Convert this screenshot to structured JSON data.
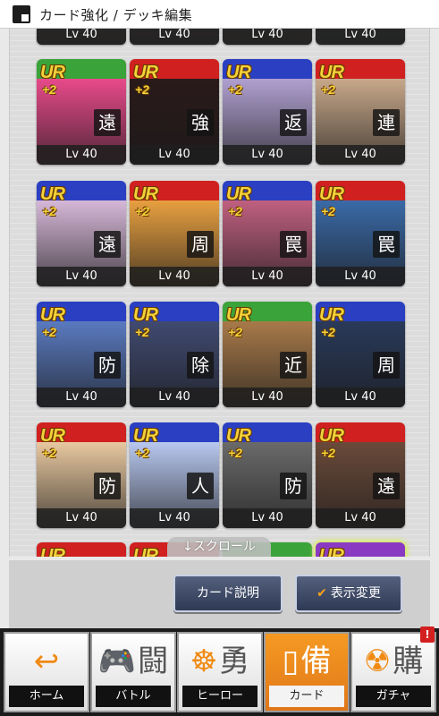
{
  "header": {
    "title": "カード強化 / デッキ編集"
  },
  "cards": [
    {
      "rarity": "UR",
      "plus": "+2",
      "kanji": "遠",
      "level": "Lv 40",
      "c1": "#3aa33a",
      "c2": "#e84a8a"
    },
    {
      "rarity": "UR",
      "plus": "+2",
      "kanji": "強",
      "level": "Lv 40",
      "c1": "#d02020",
      "c2": "#2a1a1a"
    },
    {
      "rarity": "UR",
      "plus": "+2",
      "kanji": "返",
      "level": "Lv 40",
      "c1": "#2a3fc2",
      "c2": "#b0a0d0"
    },
    {
      "rarity": "UR",
      "plus": "+2",
      "kanji": "連",
      "level": "Lv 40",
      "c1": "#d02020",
      "c2": "#c8a88a"
    },
    {
      "rarity": "UR",
      "plus": "+2",
      "kanji": "遠",
      "level": "Lv 40",
      "c1": "#2a3fc2",
      "c2": "#d6b8d8"
    },
    {
      "rarity": "UR",
      "plus": "+2",
      "kanji": "周",
      "level": "Lv 40",
      "c1": "#d02020",
      "c2": "#e8a040"
    },
    {
      "rarity": "UR",
      "plus": "+2",
      "kanji": "罠",
      "level": "Lv 40",
      "c1": "#2a3fc2",
      "c2": "#c06080"
    },
    {
      "rarity": "UR",
      "plus": "+2",
      "kanji": "罠",
      "level": "Lv 40",
      "c1": "#d02020",
      "c2": "#3a6aa8"
    },
    {
      "rarity": "UR",
      "plus": "+2",
      "kanji": "防",
      "level": "Lv 40",
      "c1": "#2a3fc2",
      "c2": "#5a7ac0"
    },
    {
      "rarity": "UR",
      "plus": "+2",
      "kanji": "除",
      "level": "Lv 40",
      "c1": "#2a3fc2",
      "c2": "#404a70"
    },
    {
      "rarity": "UR",
      "plus": "+2",
      "kanji": "近",
      "level": "Lv 40",
      "c1": "#3aa33a",
      "c2": "#a87a4a"
    },
    {
      "rarity": "UR",
      "plus": "+2",
      "kanji": "周",
      "level": "Lv 40",
      "c1": "#2a3fc2",
      "c2": "#2a3a5a"
    },
    {
      "rarity": "UR",
      "plus": "+2",
      "kanji": "防",
      "level": "Lv 40",
      "c1": "#d02020",
      "c2": "#e8c8a0"
    },
    {
      "rarity": "UR",
      "plus": "+2",
      "kanji": "人",
      "level": "Lv 40",
      "c1": "#2a3fc2",
      "c2": "#b8c8f0"
    },
    {
      "rarity": "UR",
      "plus": "+2",
      "kanji": "防",
      "level": "Lv 40",
      "c1": "#2a3fc2",
      "c2": "#6a6a6a"
    },
    {
      "rarity": "UR",
      "plus": "+2",
      "kanji": "遠",
      "level": "Lv 40",
      "c1": "#d02020",
      "c2": "#6a4a3a"
    }
  ],
  "top_partial": {
    "level": "Lv 40"
  },
  "bottom_partial": {
    "rarity": "UR"
  },
  "scroll_hint": "↓スクロール",
  "actions": {
    "info": "カード説明",
    "view": "表示変更",
    "view_check": "✔"
  },
  "nav": {
    "home": {
      "label": "ホーム",
      "glyph": "↩",
      "big": ""
    },
    "battle": {
      "label": "バトル",
      "glyph": "🎮",
      "big": "闘"
    },
    "hero": {
      "label": "ヒーロー",
      "glyph": "☸",
      "big": "勇"
    },
    "card": {
      "label": "カード",
      "glyph": "▯",
      "big": "備"
    },
    "gacha": {
      "label": "ガチャ",
      "glyph": "☢",
      "big": "購"
    }
  },
  "notification": "!"
}
